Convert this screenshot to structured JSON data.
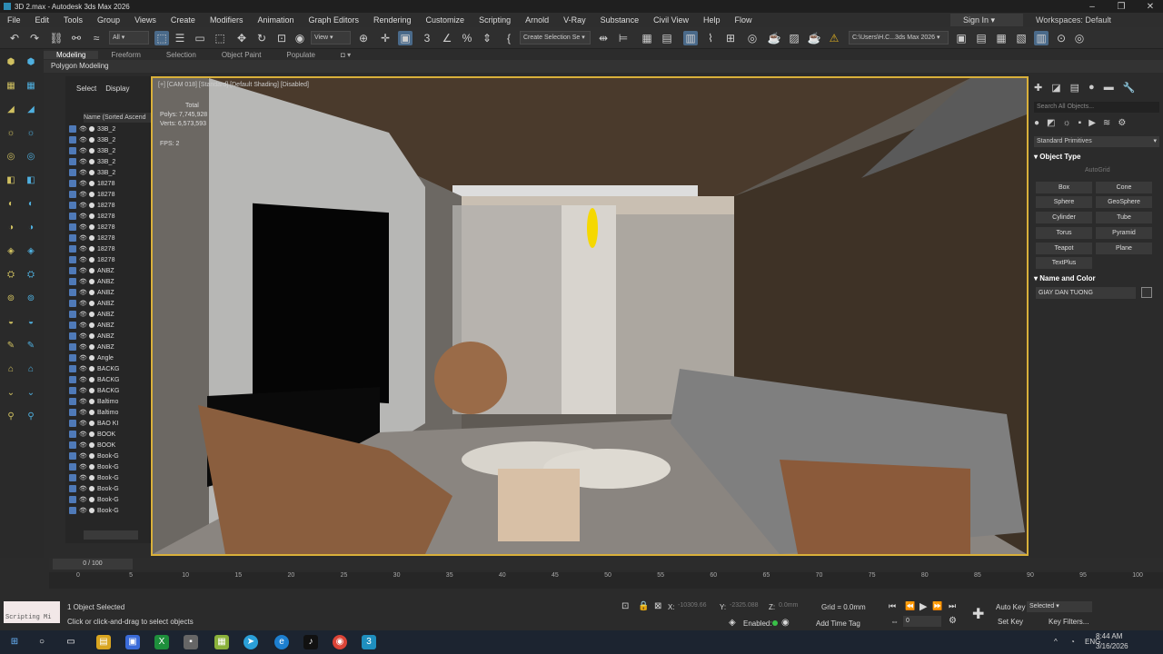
{
  "window": {
    "title": "3D 2.max - Autodesk 3ds Max 2026"
  },
  "menu": [
    "File",
    "Edit",
    "Tools",
    "Group",
    "Views",
    "Create",
    "Modifiers",
    "Animation",
    "Graph Editors",
    "Rendering",
    "Customize",
    "Scripting",
    "Arnold",
    "V-Ray",
    "Substance",
    "Civil View",
    "Help",
    "Flow"
  ],
  "header": {
    "signin": "Sign In",
    "workspaces_label": "Workspaces:",
    "workspace_value": "Default"
  },
  "toolbar": {
    "filter_value": "All",
    "view_value": "View",
    "selection_set": "Create Selection Se",
    "path": "C:\\Users\\H.C...3ds Max 2026"
  },
  "ribbon": {
    "tabs": [
      "Modeling",
      "Freeform",
      "Selection",
      "Object Paint",
      "Populate"
    ],
    "active": "Modeling",
    "subtitle": "Polygon Modeling"
  },
  "scene_explorer": {
    "tabs": [
      "Select",
      "Display"
    ],
    "column_header": "Name (Sorted Ascend",
    "items": [
      "33B_2",
      "33B_2",
      "33B_2",
      "33B_2",
      "33B_2",
      "18278",
      "18278",
      "18278",
      "18278",
      "18278",
      "18278",
      "18278",
      "18278",
      "ANBZ",
      "ANBZ",
      "ANBZ",
      "ANBZ",
      "ANBZ",
      "ANBZ",
      "ANBZ",
      "ANBZ",
      "Angle",
      "BACKG",
      "BACKG",
      "BACKG",
      "Baltimo",
      "Baltimo",
      "BAO KI",
      "BOOK",
      "BOOK",
      "Book-G",
      "Book-G",
      "Book-G",
      "Book-G",
      "Book-G",
      "Book-G"
    ]
  },
  "viewport": {
    "label": "[+] [CAM 018] [Standard] [Default Shading] [Disabled]",
    "total_label": "Total",
    "polys": "Polys: 7,745,928",
    "verts": "Verts: 6,573,593",
    "fps": "FPS:   2"
  },
  "command_panel": {
    "search_placeholder": "Search All Objects...",
    "category": "Standard Primitives",
    "object_type_title": "Object Type",
    "autogrid": "AutoGrid",
    "buttons": [
      "Box",
      "Cone",
      "Sphere",
      "GeoSphere",
      "Cylinder",
      "Tube",
      "Torus",
      "Pyramid",
      "Teapot",
      "Plane",
      "TextPlus"
    ],
    "name_color_title": "Name and Color",
    "object_name": "GIAY DAN TUONG"
  },
  "timeline": {
    "frame": "0 / 100",
    "ticks": [
      "0",
      "5",
      "10",
      "15",
      "20",
      "25",
      "30",
      "35",
      "40",
      "45",
      "50",
      "55",
      "60",
      "65",
      "70",
      "75",
      "80",
      "85",
      "90",
      "95",
      "100"
    ]
  },
  "status": {
    "scripting": "Scripting Mi",
    "selected": "1 Object Selected",
    "prompt": "Click or click-and-drag to select objects",
    "x_label": "X:",
    "x_value": "-10309.66",
    "y_label": "Y:",
    "y_value": "-2325.088",
    "z_label": "Z:",
    "z_value": "0.0mm",
    "grid": "Grid = 0.0mm",
    "enabled": "Enabled:",
    "add_time_tag": "Add Time Tag",
    "auto_key": "Auto Key",
    "set_key": "Set Key",
    "selected_dd": "Selected",
    "key_filters": "Key Filters...",
    "frame_field": "0"
  },
  "taskbar": {
    "lang": "ENG",
    "time": "8:44 AM",
    "date": "3/16/2026"
  }
}
